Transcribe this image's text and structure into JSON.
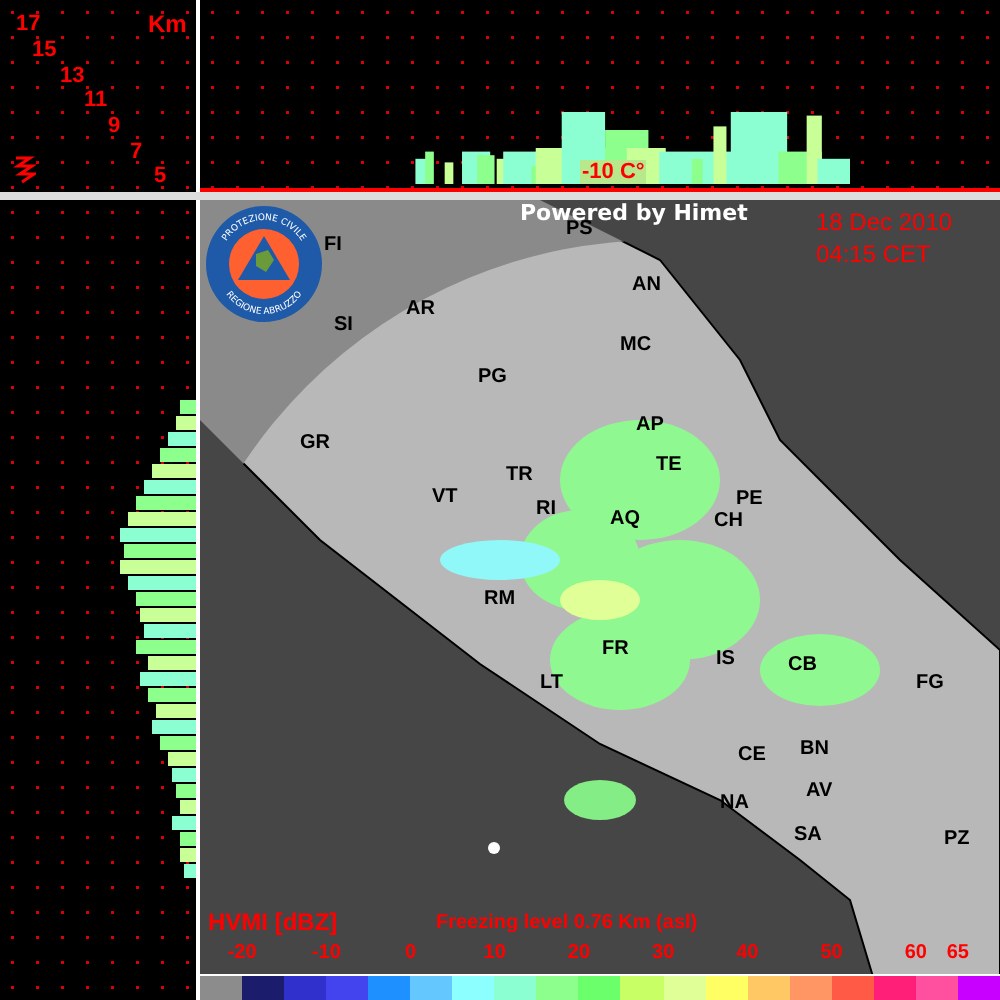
{
  "corner": {
    "unit": "Km",
    "heights": [
      "17",
      "15",
      "13",
      "11",
      "9",
      "7",
      "5"
    ]
  },
  "profile": {
    "isotherm": "-10 C°"
  },
  "map": {
    "credit": "Powered by Himet",
    "date": "18 Dec 2010",
    "time": "04:15 CET",
    "logo": {
      "top": "PROTEZIONE CIVILE",
      "bottom": "REGIONE ABRUZZO"
    },
    "cities": [
      "FI",
      "SI",
      "AR",
      "PG",
      "PS",
      "AN",
      "MC",
      "GR",
      "AP",
      "TE",
      "PE",
      "CH",
      "TR",
      "VT",
      "RI",
      "AQ",
      "RM",
      "FR",
      "LT",
      "IS",
      "CB",
      "FG",
      "CE",
      "BN",
      "AV",
      "NA",
      "SA",
      "PZ"
    ]
  },
  "legend": {
    "title": "HVMI [dBZ]",
    "freezing_level": "Freezing level  0.76 Km (asl)",
    "ticks": [
      "-20",
      "-10",
      "0",
      "10",
      "20",
      "30",
      "40",
      "50",
      "60",
      "65"
    ],
    "swatches": [
      {
        "color": "#8c8c8c"
      },
      {
        "color": "#1c1c6c"
      },
      {
        "color": "#3030cc"
      },
      {
        "color": "#4444ee"
      },
      {
        "color": "#1e90ff"
      },
      {
        "color": "#64c8ff"
      },
      {
        "color": "#8cffff"
      },
      {
        "color": "#8cffd2"
      },
      {
        "color": "#8cff8c"
      },
      {
        "color": "#6cff6c"
      },
      {
        "color": "#c8ff64"
      },
      {
        "color": "#e0ff96"
      },
      {
        "color": "#ffff64"
      },
      {
        "color": "#ffc864"
      },
      {
        "color": "#ff9664"
      },
      {
        "color": "#ff5a46"
      },
      {
        "color": "#ff1e78"
      },
      {
        "color": "#ff50a0"
      },
      {
        "color": "#c800ff"
      }
    ]
  }
}
